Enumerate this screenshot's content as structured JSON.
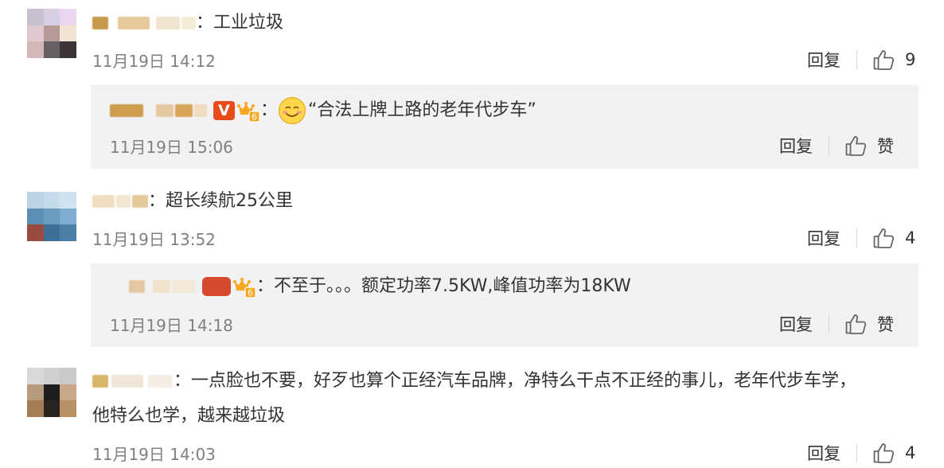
{
  "comments": [
    {
      "text": "：工业垃圾",
      "time": "11月19日 14:12",
      "reply_label": "回复",
      "like_count": "9",
      "reply": {
        "text": "“合法上牌上路的老年代步车”",
        "time": "11月19日 15:06",
        "reply_label": "回复",
        "like_label": "赞",
        "badge_v": "V",
        "badge_level": "6"
      }
    },
    {
      "text": "：超长续航25公里",
      "time": "11月19日 13:52",
      "reply_label": "回复",
      "like_count": "4",
      "reply": {
        "text": "：不至于。。。额定功率7.5KW,峰值功率为18KW",
        "time": "11月19日 14:18",
        "reply_label": "回复",
        "like_label": "赞",
        "badge_level": "6"
      }
    },
    {
      "text_line1": "：一点脸也不要，好歹也算个正经汽车品牌，净特么干点不正经的事儿，老年代步车学，",
      "text_line2": "他特么也学，越来越垃圾",
      "time": "11月19日 14:03",
      "reply_label": "回复",
      "like_count": "4"
    }
  ],
  "colors": {
    "text": "#333333",
    "time": "#808080",
    "reply_bg": "#f2f2f2",
    "icon": "#666666",
    "vip_badge": "#e84c1a",
    "level_badge": "#f7a823"
  }
}
